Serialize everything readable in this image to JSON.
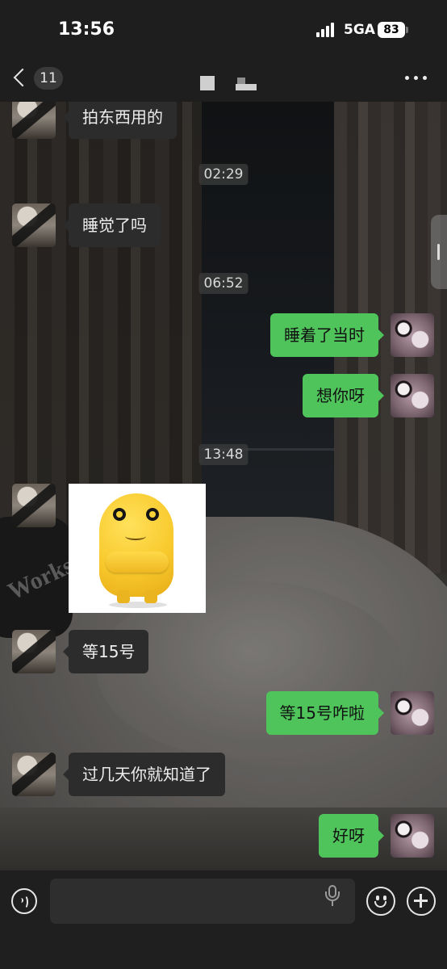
{
  "status_bar": {
    "time": "13:56",
    "network": "5GA",
    "battery": "83"
  },
  "nav": {
    "unread_count": "11"
  },
  "messages": [
    {
      "from": "them",
      "text": "拍东西用的"
    },
    {
      "timestamp": "02:29"
    },
    {
      "from": "them",
      "text": "睡觉了吗"
    },
    {
      "timestamp": "06:52"
    },
    {
      "from": "me",
      "text": "睡着了当时"
    },
    {
      "from": "me",
      "text": "想你呀"
    },
    {
      "timestamp": "13:48"
    },
    {
      "from": "them",
      "type": "sticker",
      "sticker": "yellow-blob-sticker"
    },
    {
      "from": "them",
      "text": "等15号"
    },
    {
      "from": "me",
      "text": "等15号咋啦"
    },
    {
      "from": "them",
      "text": "过几天你就知道了"
    },
    {
      "from": "me",
      "text": "好呀"
    }
  ],
  "icons": {
    "back": "chevron-left-icon",
    "more": "more-dots-icon",
    "voice": "voice-icon",
    "mic": "microphone-icon",
    "emoji": "emoji-icon",
    "plus": "plus-icon"
  },
  "colors": {
    "my_bubble": "#4ec45b",
    "their_bubble": "#2c2c2c"
  }
}
